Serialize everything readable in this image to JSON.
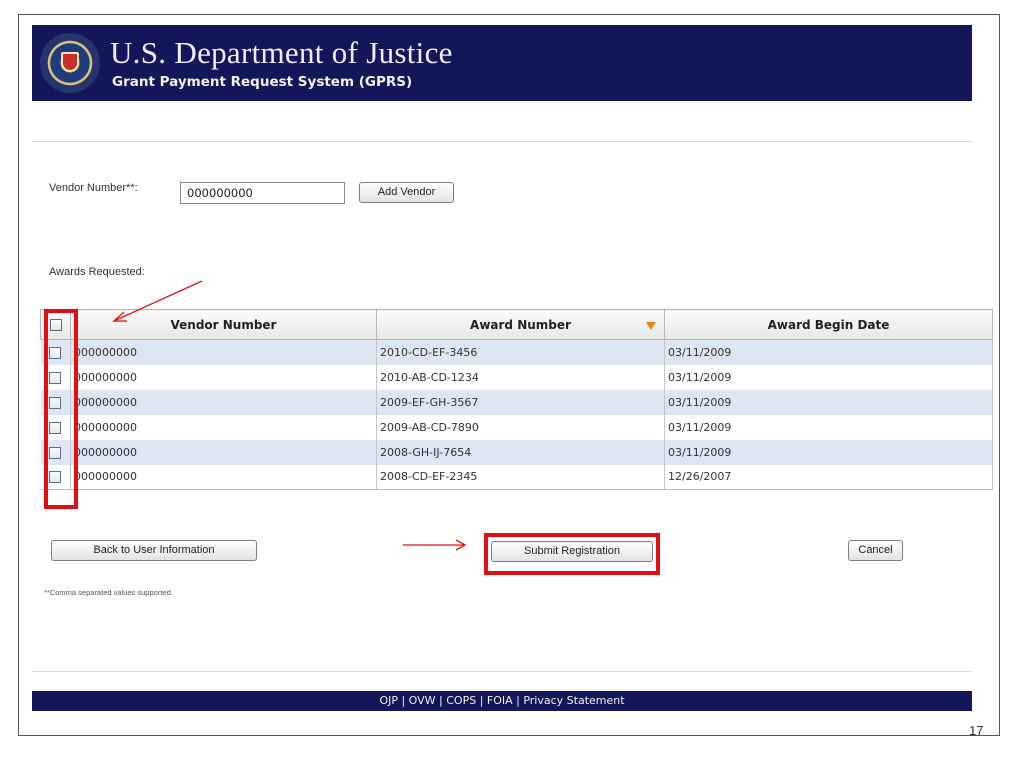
{
  "header": {
    "title": "U.S. Department of Justice",
    "subtitle": "Grant Payment Request System (GPRS)"
  },
  "form": {
    "vendor_label": "Vendor Number**:",
    "vendor_value": "000000000",
    "add_vendor_label": "Add Vendor",
    "awards_label": "Awards Requested:"
  },
  "table": {
    "columns": [
      "Vendor Number",
      "Award Number",
      "Award Begin Date"
    ],
    "rows": [
      {
        "vendor": "000000000",
        "award": "2010-CD-EF-3456",
        "date": "03/11/2009"
      },
      {
        "vendor": "000000000",
        "award": "2010-AB-CD-1234",
        "date": "03/11/2009"
      },
      {
        "vendor": "000000000",
        "award": "2009-EF-GH-3567",
        "date": "03/11/2009"
      },
      {
        "vendor": "000000000",
        "award": "2009-AB-CD-7890",
        "date": "03/11/2009"
      },
      {
        "vendor": "000000000",
        "award": "2008-GH-IJ-7654",
        "date": "03/11/2009"
      },
      {
        "vendor": "000000000",
        "award": "2008-CD-EF-2345",
        "date": "12/26/2007"
      }
    ]
  },
  "buttons": {
    "back": "Back to User Information",
    "submit": "Submit Registration",
    "cancel": "Cancel"
  },
  "note": "**Comma separated values supported.",
  "footer": {
    "links": "OJP | OVW | COPS | FOIA | Privacy Statement"
  },
  "page_number": "17",
  "colors": {
    "header_bg": "#131659",
    "highlight": "#e01010",
    "row_alt": "#dde6f3",
    "sort_icon": "#e08a16"
  },
  "icons": [
    "doj-seal-icon",
    "sort-desc-icon",
    "checkbox-icon",
    "arrow-annotation-icon"
  ]
}
